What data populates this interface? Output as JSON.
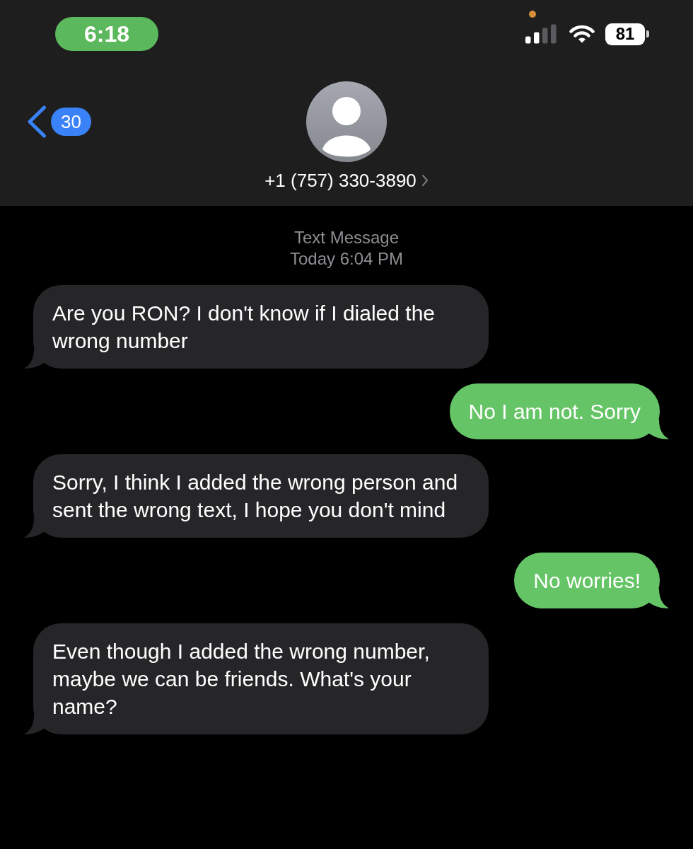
{
  "status_bar": {
    "time": "6:18",
    "call_active": true,
    "mic_in_use": true,
    "battery": "81"
  },
  "header": {
    "unread_count": "30",
    "contact": "+1 (757) 330-3890"
  },
  "thread": {
    "service": "Text Message",
    "timestamp": "Today 6:04 PM",
    "messages": [
      {
        "kind": "received",
        "text": "Are you RON? I don't know if I dialed the wrong number"
      },
      {
        "kind": "sent",
        "text": "No I am not. Sorry"
      },
      {
        "kind": "received",
        "text": "Sorry, I think I added the wrong person and sent the wrong text, I hope you don't mind"
      },
      {
        "kind": "sent",
        "text": "No worries!"
      },
      {
        "kind": "received",
        "text": "Even though I added the wrong number, maybe we can be friends. What's your name?"
      }
    ]
  }
}
